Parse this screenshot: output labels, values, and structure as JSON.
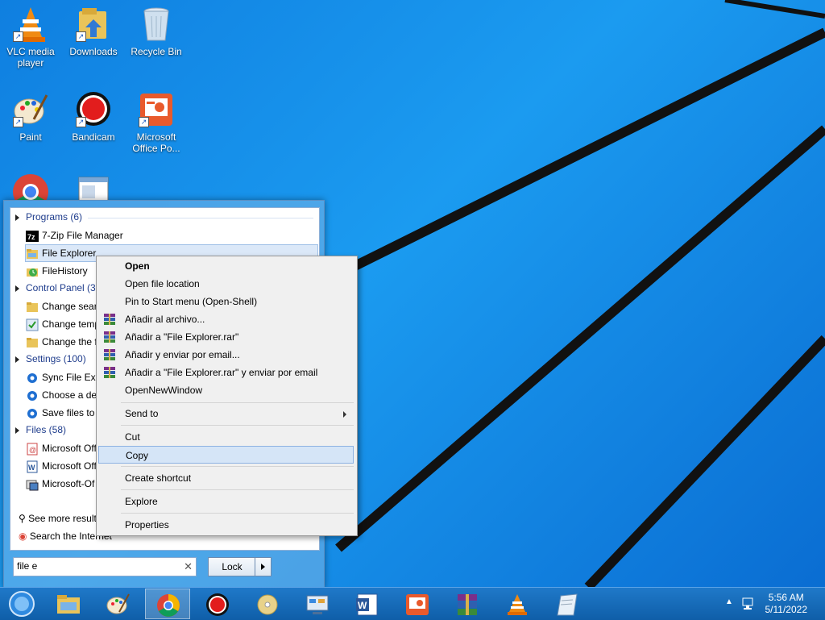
{
  "desktop": {
    "icons": [
      {
        "label": "VLC media player"
      },
      {
        "label": "Downloads"
      },
      {
        "label": "Recycle Bin"
      },
      {
        "label": "Paint"
      },
      {
        "label": "Bandicam"
      },
      {
        "label": "Microsoft Office Po..."
      }
    ]
  },
  "start_menu": {
    "groups": {
      "programs": "Programs (6)",
      "control_panel": "Control Panel (30)",
      "settings": "Settings (100)",
      "files": "Files (58)"
    },
    "items": {
      "zip": "7-Zip File Manager",
      "file_explorer": "File Explorer",
      "filehistory": "FileHistory",
      "cp1": "Change search",
      "cp2": "Change temp",
      "cp3": "Change the fi",
      "set1": "Sync File Expl",
      "set2": "Choose a def",
      "set3": "Save files to a",
      "f1": "Microsoft Off",
      "f2": "Microsoft Off",
      "f3": "Microsoft-Of"
    },
    "see_more": "See more results",
    "search_internet": "Search the Internet",
    "search_value": "file e",
    "lock_label": "Lock"
  },
  "context_menu": {
    "open": "Open",
    "open_location": "Open file location",
    "pin": "Pin to Start menu (Open-Shell)",
    "rar1": "Añadir al archivo...",
    "rar2": "Añadir a \"File Explorer.rar\"",
    "rar3": "Añadir y enviar por email...",
    "rar4": "Añadir a \"File Explorer.rar\" y enviar por email",
    "open_new_window": "OpenNewWindow",
    "send_to": "Send to",
    "cut": "Cut",
    "copy": "Copy",
    "create_shortcut": "Create shortcut",
    "explore": "Explore",
    "properties": "Properties"
  },
  "taskbar": {
    "time": "5:56 AM",
    "date": "5/11/2022"
  }
}
